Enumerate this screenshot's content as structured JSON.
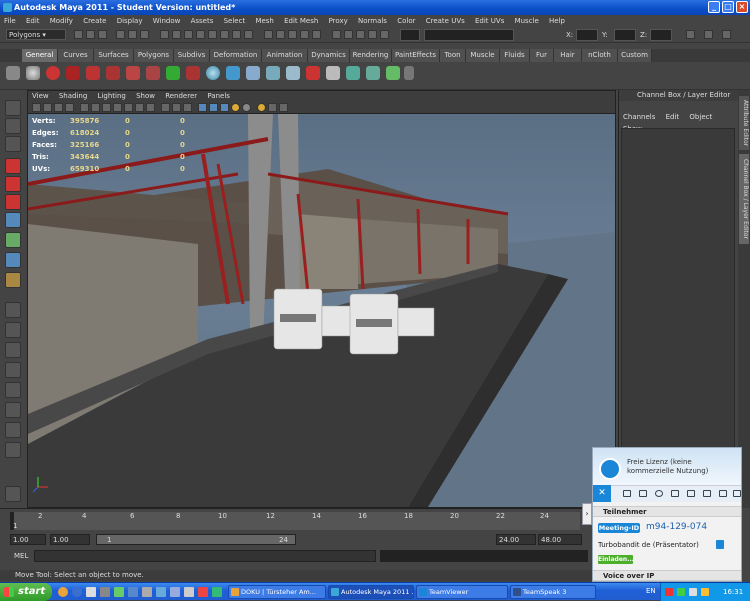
{
  "window": {
    "title": "Autodesk Maya 2011 - Student Version: untitled*"
  },
  "menubar": [
    "File",
    "Edit",
    "Modify",
    "Create",
    "Display",
    "Window",
    "Assets",
    "Select",
    "Mesh",
    "Edit Mesh",
    "Proxy",
    "Normals",
    "Color",
    "Create UVs",
    "Edit UVs",
    "Muscle",
    "Help"
  ],
  "statusline": {
    "mode": "Polygons",
    "x_label": "X:",
    "y_label": "Y:",
    "z_label": "Z:"
  },
  "shelf_tabs": [
    "General",
    "Curves",
    "Surfaces",
    "Polygons",
    "Subdivs",
    "Deformation",
    "Animation",
    "Dynamics",
    "Rendering",
    "PaintEffects",
    "Toon",
    "Muscle",
    "Fluids",
    "Fur",
    "Hair",
    "nCloth",
    "Custom"
  ],
  "active_shelf_tab": "General",
  "viewport": {
    "menu": [
      "View",
      "Shading",
      "Lighting",
      "Show",
      "Renderer",
      "Panels"
    ],
    "hud": [
      {
        "label": "Verts:",
        "a": "395876",
        "b": "0",
        "c": "0"
      },
      {
        "label": "Edges:",
        "a": "618024",
        "b": "0",
        "c": "0"
      },
      {
        "label": "Faces:",
        "a": "325166",
        "b": "0",
        "c": "0"
      },
      {
        "label": "Tris:",
        "a": "343644",
        "b": "0",
        "c": "0"
      },
      {
        "label": "UVs:",
        "a": "659310",
        "b": "0",
        "c": "0"
      }
    ]
  },
  "channel_box": {
    "title": "Channel Box / Layer Editor",
    "menu": [
      "Channels",
      "Edit",
      "Object",
      "Show"
    ]
  },
  "side_tabs": [
    "Attribute Editor",
    "Channel Box / Layer Editor"
  ],
  "timeline": {
    "ticks": [
      "1",
      "2",
      "4",
      "6",
      "8",
      "10",
      "12",
      "14",
      "16",
      "18",
      "20",
      "22",
      "24"
    ],
    "current_frame": "1",
    "start": "1.00",
    "start2": "1.00",
    "range_start": "1",
    "range_end": "24",
    "end": "24.00",
    "end2": "48.00"
  },
  "command_line": {
    "label": "MEL"
  },
  "help_line": "Move Tool: Select an object to move.",
  "teamviewer": {
    "free_license": "Freie Lizenz (keine kommerzielle Nutzung)",
    "participants_header": "Teilnehmer",
    "meeting_label": "Meeting-ID",
    "meeting_id": "m94-129-074",
    "presenter": "Turbobandit de (Präsentator)",
    "invite_button": "Einladen...",
    "voip_header": "Voice over IP",
    "brand_color": "#1a86d8"
  },
  "taskbar": {
    "start": "start",
    "tasks": [
      {
        "label": "DOKU | Türsteher Am..."
      },
      {
        "label": "Autodesk Maya 2011 ..."
      },
      {
        "label": "TeamViewer"
      },
      {
        "label": "TeamSpeak 3"
      }
    ],
    "language": "EN",
    "clock": "16:31"
  }
}
